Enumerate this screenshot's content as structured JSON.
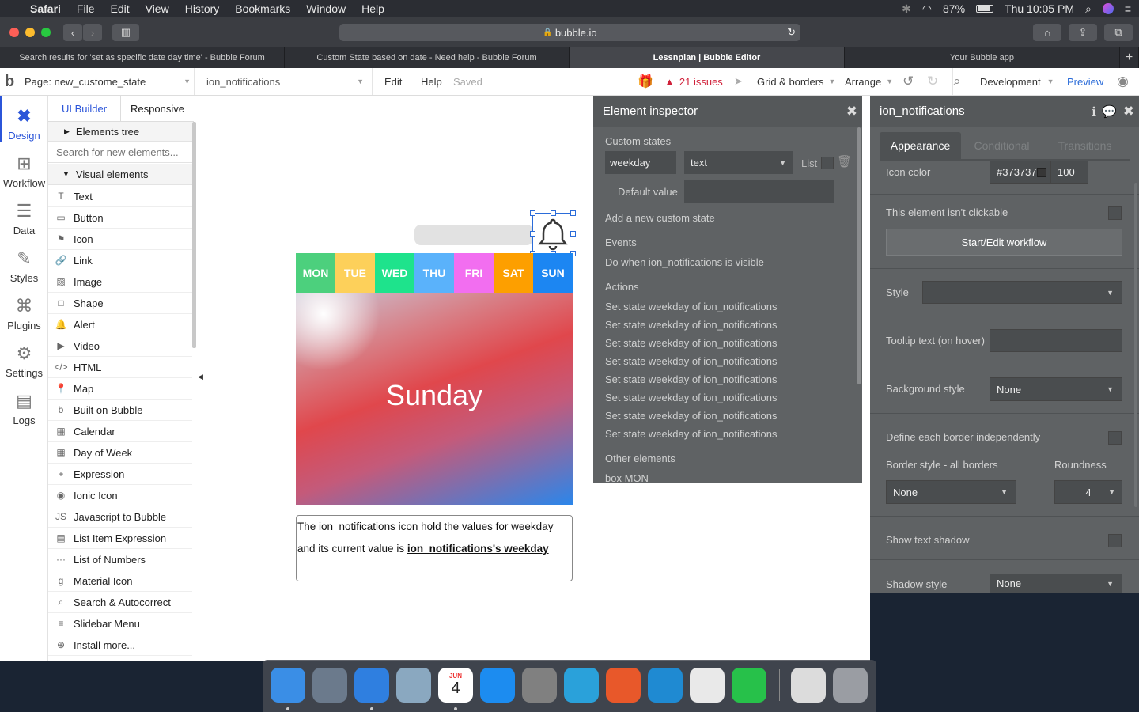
{
  "menubar": {
    "app": "Safari",
    "menus": [
      "File",
      "Edit",
      "View",
      "History",
      "Bookmarks",
      "Window",
      "Help"
    ],
    "battery": "87%",
    "clock": "Thu 10:05 PM"
  },
  "browser": {
    "url": "bubble.io",
    "tabs": [
      "Search results for 'set as specific date day time' - Bubble Forum",
      "Custom State based on date - Need help - Bubble Forum",
      "Lessnplan | Bubble Editor",
      "Your Bubble app"
    ],
    "active_tab_index": 2
  },
  "header": {
    "page_label": "Page: new_custome_state",
    "element_select": "ion_notifications",
    "edit": "Edit",
    "help": "Help",
    "saved": "Saved",
    "issues": "21 issues",
    "grid": "Grid & borders",
    "arrange": "Arrange",
    "env": "Development",
    "preview": "Preview"
  },
  "sidebar": {
    "items": [
      {
        "label": "Design",
        "icon": "design-icon"
      },
      {
        "label": "Workflow",
        "icon": "workflow-icon"
      },
      {
        "label": "Data",
        "icon": "database-icon"
      },
      {
        "label": "Styles",
        "icon": "brush-icon"
      },
      {
        "label": "Plugins",
        "icon": "plug-icon"
      },
      {
        "label": "Settings",
        "icon": "gear-icon"
      },
      {
        "label": "Logs",
        "icon": "document-icon"
      }
    ]
  },
  "elements_panel": {
    "tab_ui": "UI Builder",
    "tab_responsive": "Responsive",
    "tree": "Elements tree",
    "search_placeholder": "Search for new elements...",
    "section": "Visual elements",
    "items": [
      {
        "label": "Text",
        "glyph": "T"
      },
      {
        "label": "Button",
        "glyph": "▭"
      },
      {
        "label": "Icon",
        "glyph": "⚑"
      },
      {
        "label": "Link",
        "glyph": "🔗"
      },
      {
        "label": "Image",
        "glyph": "▨"
      },
      {
        "label": "Shape",
        "glyph": "□"
      },
      {
        "label": "Alert",
        "glyph": "🔔"
      },
      {
        "label": "Video",
        "glyph": "▶"
      },
      {
        "label": "HTML",
        "glyph": "</>"
      },
      {
        "label": "Map",
        "glyph": "📍"
      },
      {
        "label": "Built on Bubble",
        "glyph": "b"
      },
      {
        "label": "Calendar",
        "glyph": "▦"
      },
      {
        "label": "Day of Week",
        "glyph": "▦"
      },
      {
        "label": "Expression",
        "glyph": "+"
      },
      {
        "label": "Ionic Icon",
        "glyph": "◉"
      },
      {
        "label": "Javascript to Bubble",
        "glyph": "JS"
      },
      {
        "label": "List Item Expression",
        "glyph": "▤"
      },
      {
        "label": "List of Numbers",
        "glyph": "···"
      },
      {
        "label": "Material Icon",
        "glyph": "g"
      },
      {
        "label": "Search & Autocorrect",
        "glyph": "⌕"
      },
      {
        "label": "Slidebar Menu",
        "glyph": "≡"
      },
      {
        "label": "Install more...",
        "glyph": "⊕"
      }
    ]
  },
  "canvas": {
    "days": [
      {
        "label": "MON",
        "color": "#4cd07d"
      },
      {
        "label": "TUE",
        "color": "#fdd05a"
      },
      {
        "label": "WED",
        "color": "#1ee38c"
      },
      {
        "label": "THU",
        "color": "#5ab2fb"
      },
      {
        "label": "FRI",
        "color": "#f26ef0"
      },
      {
        "label": "SAT",
        "color": "#fd9f00"
      },
      {
        "label": "SUN",
        "color": "#1c86f2"
      }
    ],
    "big_day": "Sunday",
    "text_prefix": "The ion_notifications icon hold the values for weekday and its current value is ",
    "text_dynamic": "ion_notifications's weekday"
  },
  "inspector": {
    "title": "Element inspector",
    "custom_states": "Custom states",
    "state_name": "weekday",
    "state_type": "text",
    "list": "List",
    "default_value": "Default value",
    "add_state": "Add a new custom state",
    "events": "Events",
    "event_item": "Do when ion_notifications is visible",
    "actions": "Actions",
    "action_items": [
      "Set state weekday of ion_notifications",
      "Set state weekday of ion_notifications",
      "Set state weekday of ion_notifications",
      "Set state weekday of ion_notifications",
      "Set state weekday of ion_notifications",
      "Set state weekday of ion_notifications",
      "Set state weekday of ion_notifications",
      "Set state weekday of ion_notifications"
    ],
    "other": "Other elements",
    "other_item": "box MON"
  },
  "property_editor": {
    "title": "ion_notifications",
    "tabs": [
      "Appearance",
      "Conditional",
      "Transitions"
    ],
    "icon_color_label": "Icon color",
    "icon_color": "#373737",
    "opacity": "100",
    "not_clickable": "This element isn't clickable",
    "workflow_btn": "Start/Edit workflow",
    "style": "Style",
    "tooltip": "Tooltip text (on hover)",
    "bg_style": "Background style",
    "bg_value": "None",
    "border_indep": "Define each border independently",
    "border_style": "Border style - all borders",
    "roundness": "Roundness",
    "border_value": "None",
    "roundness_value": "4",
    "text_shadow": "Show text shadow",
    "shadow_style": "Shadow style",
    "shadow_value": "None"
  },
  "dock": {
    "apps": [
      {
        "name": "Finder",
        "color": "#3a8ee6"
      },
      {
        "name": "Launchpad",
        "color": "#6b7a8c"
      },
      {
        "name": "Safari",
        "color": "#2f7fe0"
      },
      {
        "name": "Preview",
        "color": "#8aa8c0"
      },
      {
        "name": "Calendar",
        "color": "#ffffff",
        "text": "4",
        "month": "JUN"
      },
      {
        "name": "App Store",
        "color": "#1c8cf0"
      },
      {
        "name": "System Preferences",
        "color": "#808080"
      },
      {
        "name": "Telegram",
        "color": "#2aa1da"
      },
      {
        "name": "Firefox",
        "color": "#e8582a"
      },
      {
        "name": "VS Code",
        "color": "#1f8ad2"
      },
      {
        "name": "Chrome",
        "color": "#e9e9e9"
      },
      {
        "name": "WhatsApp",
        "color": "#27c14a"
      },
      {
        "name": "Documents",
        "color": "#dcdcdc"
      },
      {
        "name": "Trash",
        "color": "#9a9da3"
      }
    ]
  }
}
